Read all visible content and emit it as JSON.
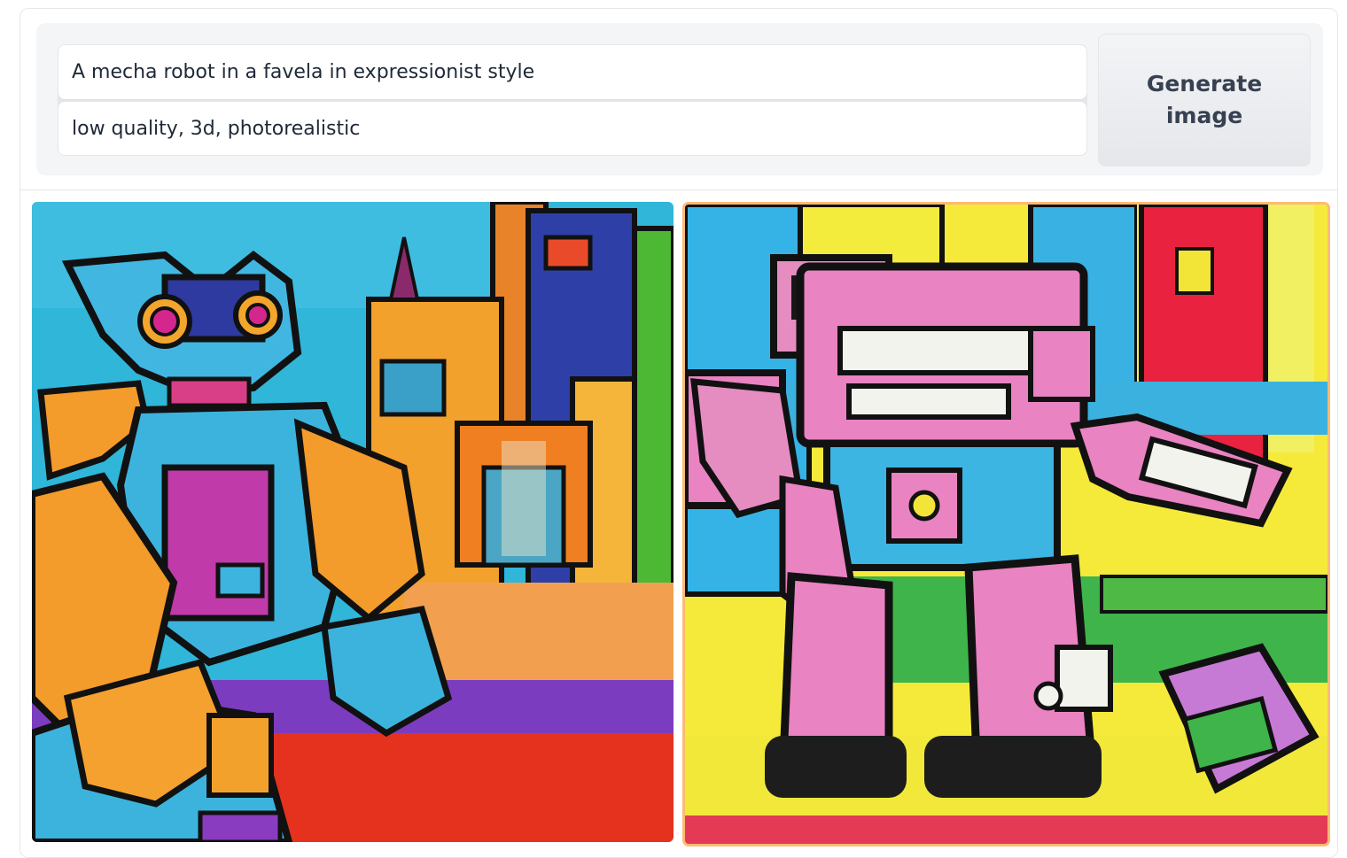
{
  "prompt": {
    "text": "A mecha robot in a favela in expressionist style",
    "negative": "low quality, 3d, photorealistic"
  },
  "generate_button": {
    "label": "Generate image"
  },
  "gallery": {
    "images": [
      {
        "name": "generated-image-1",
        "selected": false
      },
      {
        "name": "generated-image-2",
        "selected": true
      }
    ],
    "selected_border_color": "#fdba74"
  }
}
